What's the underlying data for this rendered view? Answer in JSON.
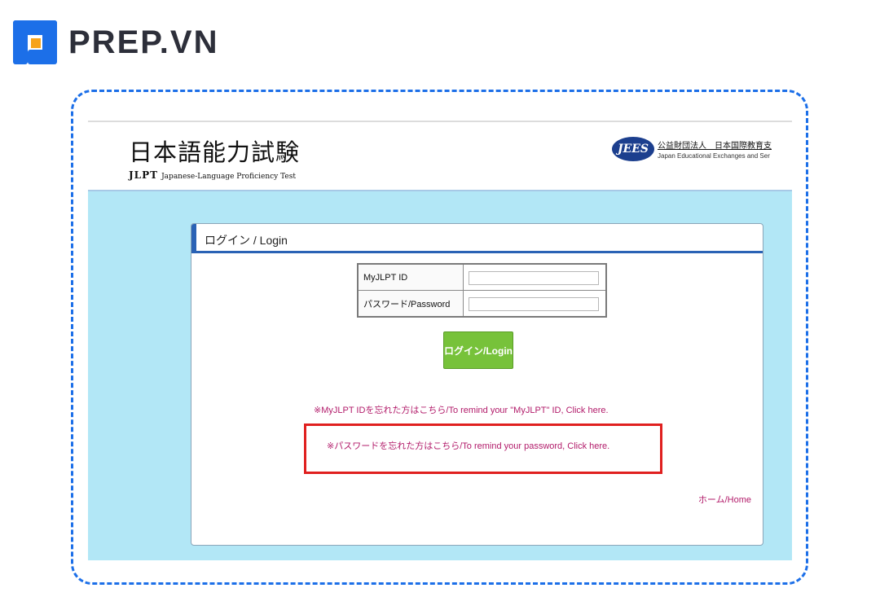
{
  "brand": {
    "name": "PREP.VN"
  },
  "header": {
    "jlpt_title": "日本語能力試験",
    "jlpt_mark": "JLPT",
    "jlpt_subtitle": "Japanese-Language Proficiency Test",
    "jees_logo": "JEES",
    "jees_jp": "公益財団法人　日本国際教育支",
    "jees_en": "Japan Educational Exchanges and Ser"
  },
  "panel": {
    "title": "ログイン / Login",
    "fields": [
      {
        "label": "MyJLPT ID",
        "value": ""
      },
      {
        "label": "パスワード/Password",
        "value": ""
      }
    ],
    "login_button": "ログイン/Login",
    "forgot_id_link": "※MyJLPT IDを忘れた方はこちら/To remind your \"MyJLPT\" ID, Click here.",
    "forgot_password_link": "※パスワードを忘れた方はこちら/To remind your password, Click here.",
    "home_link": "ホーム/Home"
  },
  "colors": {
    "brand_blue": "#1c6fe8",
    "brand_orange": "#f6a31b",
    "content_bg": "#b2e7f6",
    "login_green": "#77c23a",
    "link_color": "#b21b6a",
    "highlight_red": "#e0201f"
  }
}
